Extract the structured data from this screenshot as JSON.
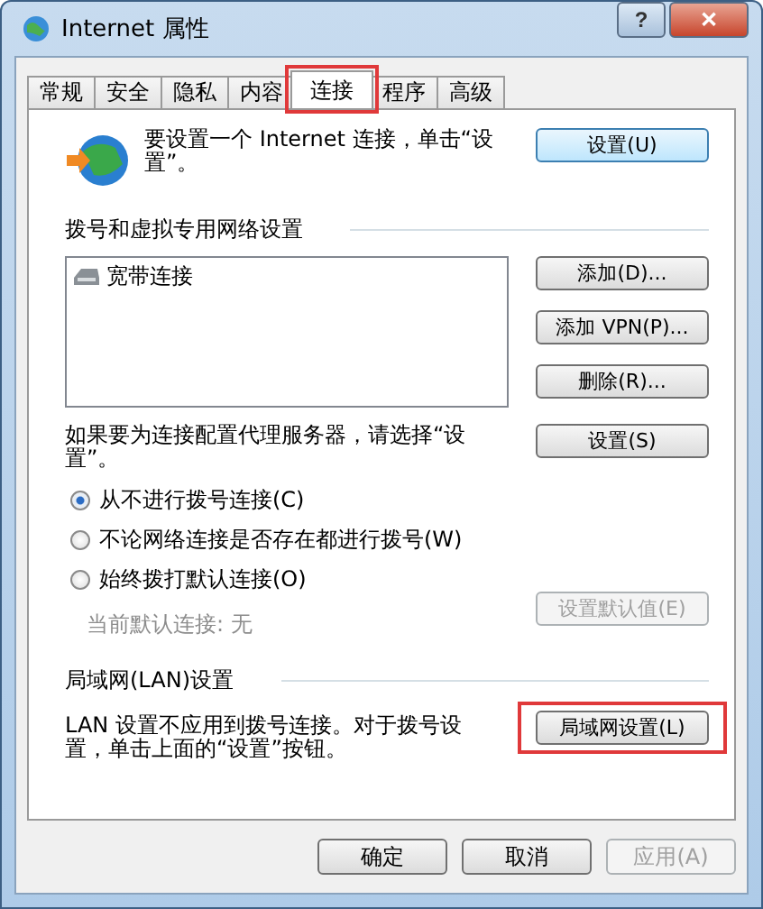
{
  "window": {
    "title": "Internet 属性"
  },
  "title_buttons": [
    {
      "kind": "help",
      "label": "?"
    },
    {
      "kind": "close",
      "label": "✕"
    }
  ],
  "tabs": [
    {
      "label": "常规",
      "selected": false,
      "highlighted": false
    },
    {
      "label": "安全",
      "selected": false,
      "highlighted": false
    },
    {
      "label": "隐私",
      "selected": false,
      "highlighted": false
    },
    {
      "label": "内容",
      "selected": false,
      "highlighted": false
    },
    {
      "label": "连接",
      "selected": true,
      "highlighted": true
    },
    {
      "label": "程序",
      "selected": false,
      "highlighted": false
    },
    {
      "label": "高级",
      "selected": false,
      "highlighted": false
    }
  ],
  "setup": {
    "text": "要设置一个 Internet 连接，单击“设置”。",
    "button": "设置(U)"
  },
  "dialup": {
    "heading": "拨号和虚拟专用网络设置",
    "connections": [
      {
        "label": "宽带连接",
        "selected": false
      }
    ],
    "buttons": [
      {
        "label": "添加(D)...",
        "disabled": false
      },
      {
        "label": "添加 VPN(P)...",
        "disabled": false
      },
      {
        "label": "删除(R)...",
        "disabled": false
      }
    ],
    "proxy_text": "如果要为连接配置代理服务器，请选择“设置”。",
    "proxy_button": "设置(S)",
    "options": [
      {
        "label": "从不进行拨号连接(C)",
        "selected": true
      },
      {
        "label": "不论网络连接是否存在都进行拨号(W)",
        "selected": false
      },
      {
        "label": "始终拨打默认连接(O)",
        "selected": false
      }
    ],
    "default_label": "当前默认连接: 无",
    "default_disabled": true,
    "default_button": "设置默认值(E)"
  },
  "lan": {
    "heading": "局域网(LAN)设置",
    "text": "LAN 设置不应用到拨号连接。对于拨号设置，单击上面的“设置”按钮。",
    "button": "局域网设置(L)",
    "highlighted": true
  },
  "footer_buttons": [
    {
      "label": "确定",
      "disabled": false
    },
    {
      "label": "取消",
      "disabled": false
    },
    {
      "label": "应用(A)",
      "disabled": true
    }
  ]
}
